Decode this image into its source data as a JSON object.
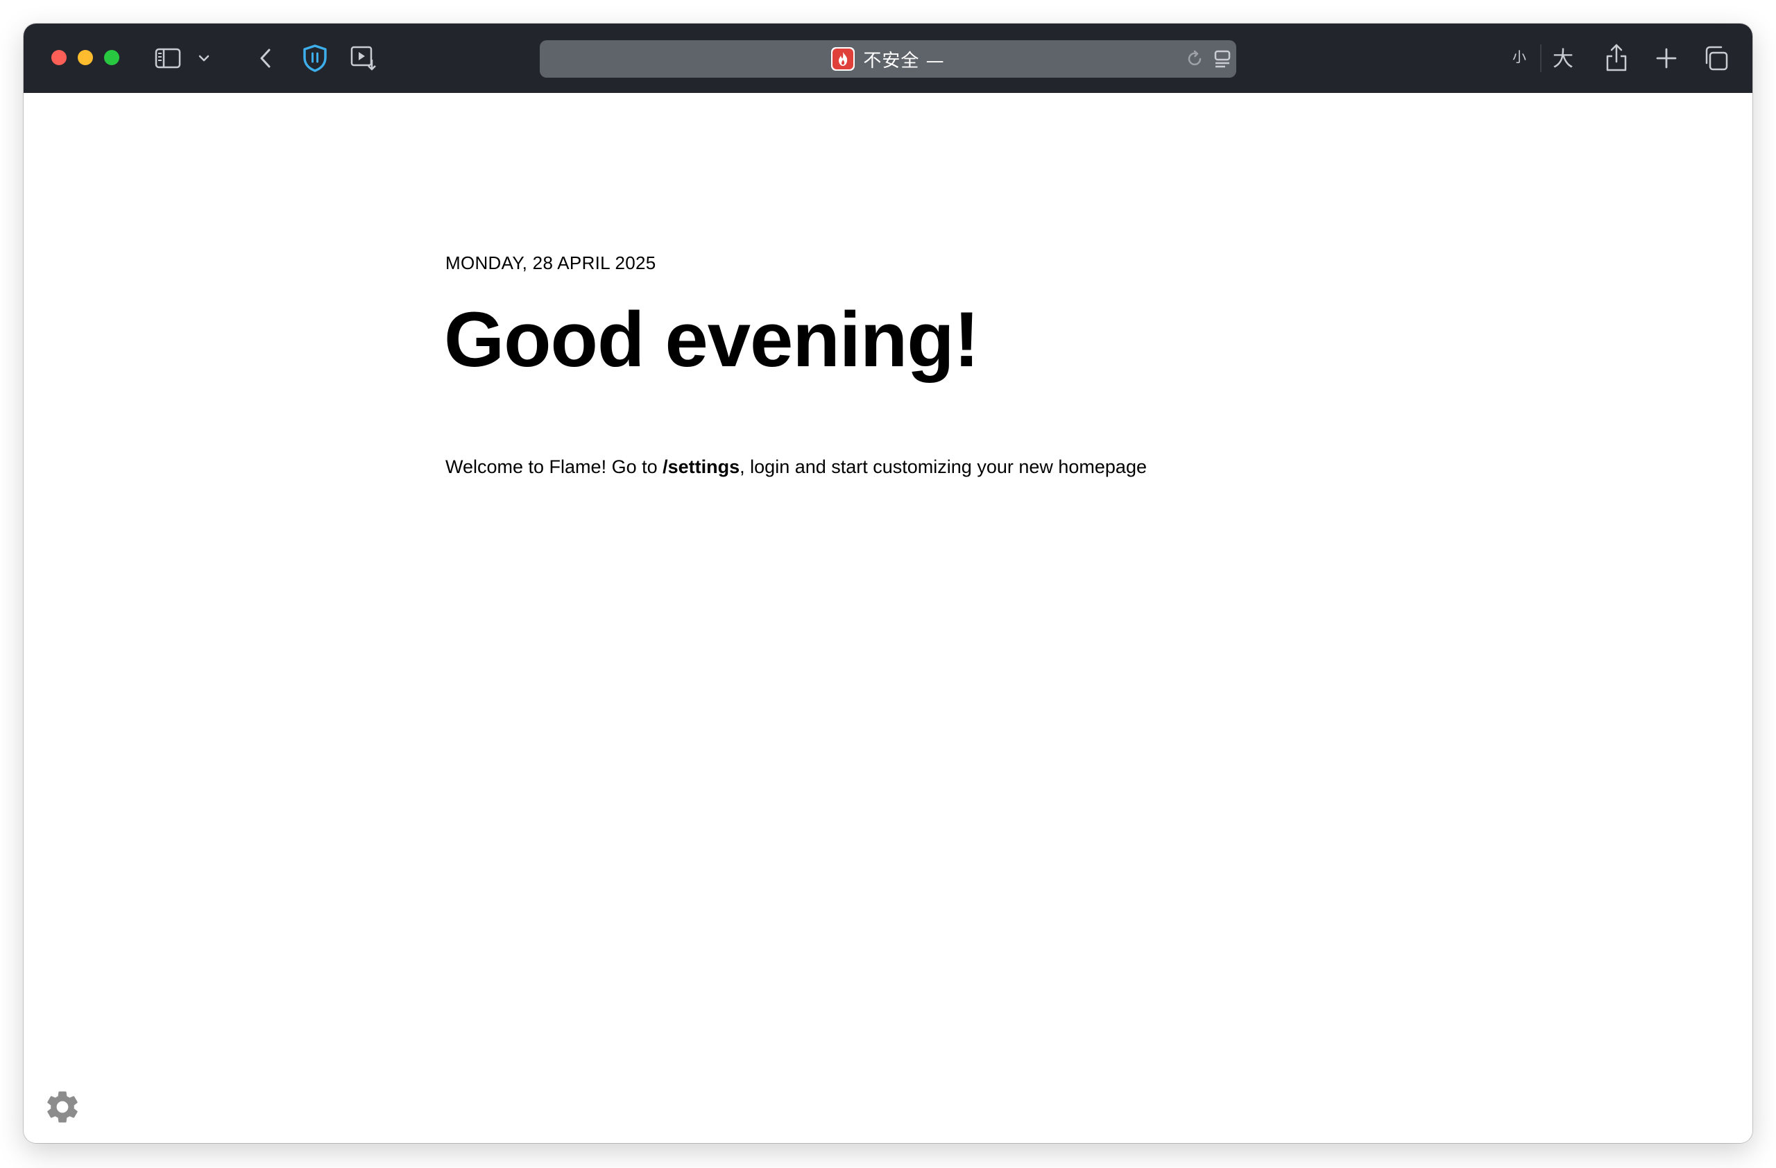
{
  "browser": {
    "address_text": "不安全 —",
    "font_small_label": "小",
    "font_large_label": "大",
    "icons": {
      "sidebar": "sidebar-icon",
      "sidebar_menu": "chevron-down-icon",
      "back": "chevron-left-icon",
      "privacy": "shield-icon",
      "media": "media-download-icon",
      "reload": "reload-icon",
      "reader": "reader-icon",
      "share": "share-icon",
      "new_tab": "plus-icon",
      "tabs_overview": "tabs-icon"
    },
    "colors": {
      "toolbar_bg": "#22262c",
      "address_bg": "#5f646b",
      "close": "#fe5f57",
      "minimize": "#febc2e",
      "zoom": "#28c840",
      "shield": "#3daee9",
      "favicon_flame": "#e0403a"
    }
  },
  "page": {
    "date": "MONDAY, 28 APRIL 2025",
    "greeting": "Good evening!",
    "welcome_before": "Welcome to Flame! Go to ",
    "welcome_link": "/settings",
    "welcome_after": ", login and start customizing your new homepage",
    "settings_icon": "gear-icon"
  }
}
